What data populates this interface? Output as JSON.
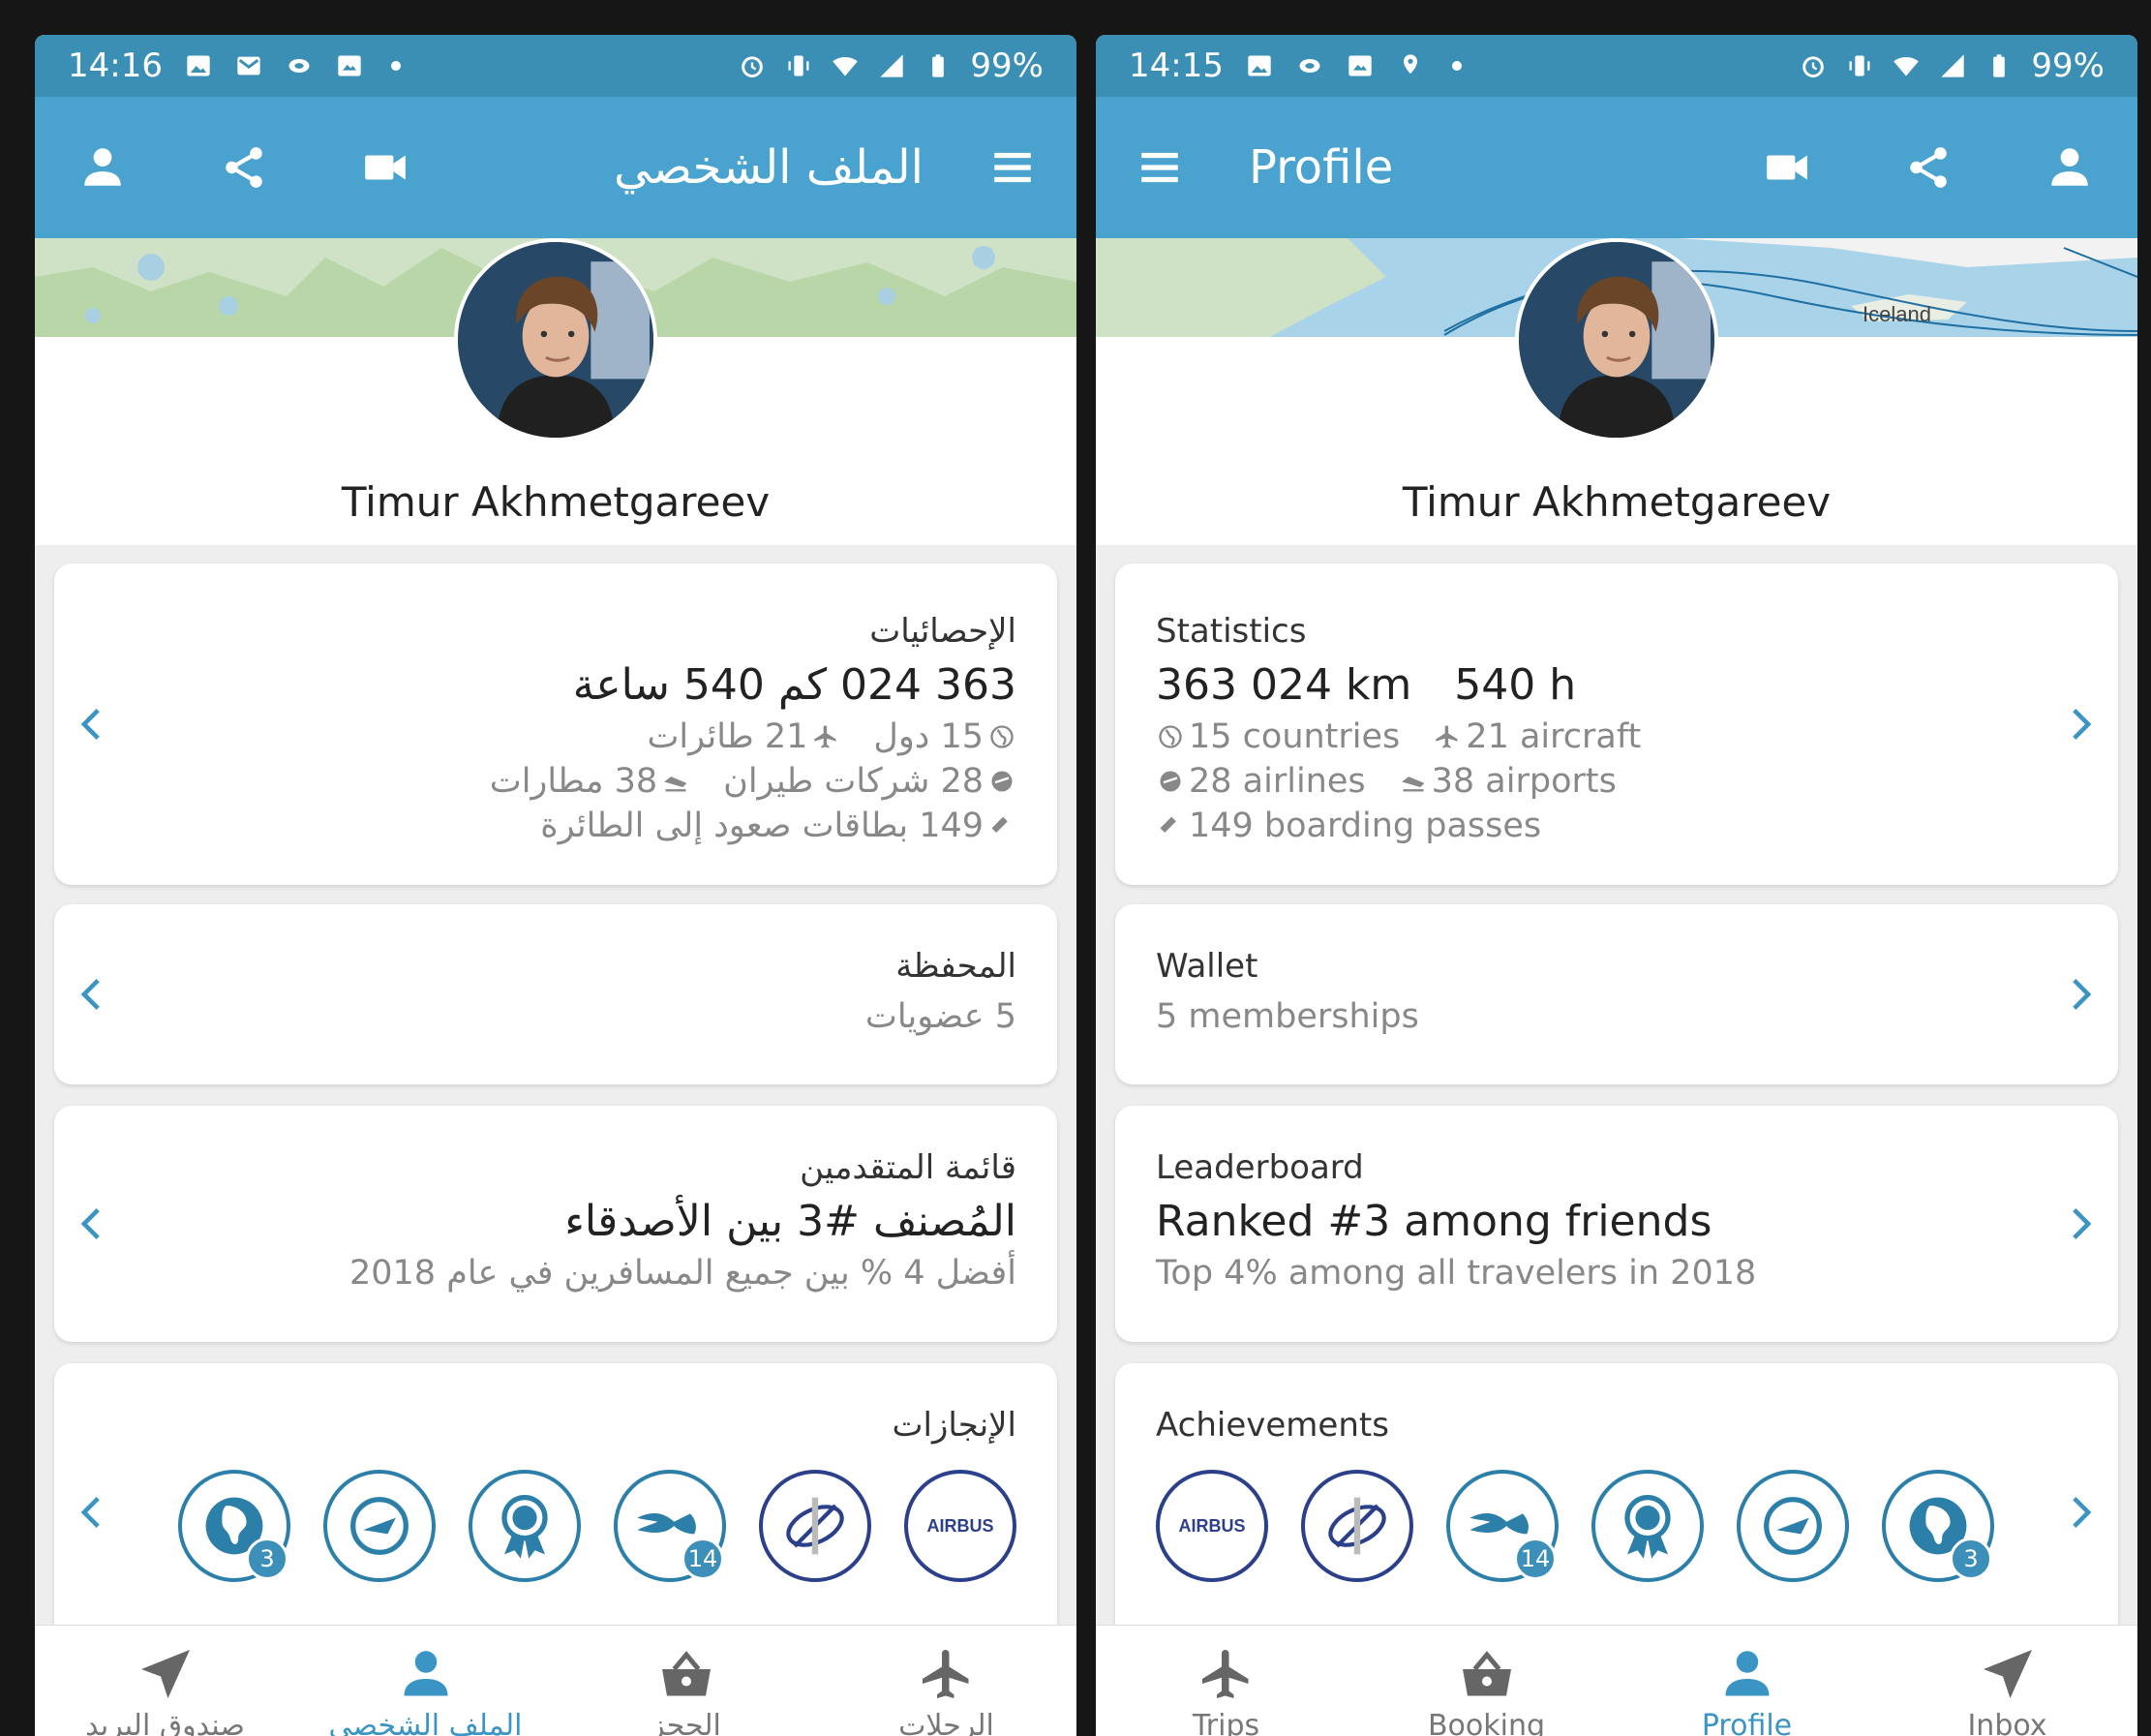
{
  "colors": {
    "statusbar": "#3b8fb5",
    "appbar": "#4aa3cf",
    "accent": "#3b95c4",
    "badge_blue": "#2b7fa9",
    "badge_navy": "#2c3f8a",
    "nav_inactive": "#666666"
  },
  "left": {
    "statusbar": {
      "time": "14:16",
      "left_icons": [
        "image-icon",
        "gmail-icon",
        "ring-icon",
        "photo-icon",
        "dot-icon"
      ],
      "right_icons": [
        "alarm-icon",
        "vibrate-icon",
        "wifi-icon",
        "signal-icon",
        "battery-icon"
      ],
      "battery": "99%"
    },
    "appbar": {
      "title": "الملف الشخصي",
      "icons": [
        "person-icon",
        "share-icon",
        "videocam-icon",
        "menu-icon"
      ]
    },
    "profile": {
      "name": "Timur Akhmetgareev"
    },
    "statistics": {
      "title": "الإحصائيات",
      "totals": "363 024 كم   540 ساعة",
      "countries": "15 دول",
      "aircraft": "21 طائرات",
      "airlines": "28 شركات طيران",
      "airports": "38 مطارات",
      "boarding_passes": "149 بطاقات صعود إلى الطائرة"
    },
    "wallet": {
      "title": "المحفظة",
      "subtitle": "5 عضويات"
    },
    "leaderboard": {
      "title": "قائمة المتقدمين",
      "rank": "المُصنف #3 بين الأصدقاء",
      "subtitle": "أفضل 4 % بين جميع المسافرين في عام 2018"
    },
    "achievements": {
      "title": "الإنجازات",
      "badges": [
        {
          "icon": "airbus-badge-icon",
          "text": "AIRBUS",
          "count": ""
        },
        {
          "icon": "boeing-badge-icon",
          "count": ""
        },
        {
          "icon": "eagle-badge-icon",
          "count": "14"
        },
        {
          "icon": "medal-badge-icon",
          "count": ""
        },
        {
          "icon": "globe-plane-badge-icon",
          "count": ""
        },
        {
          "icon": "africa-globe-badge-icon",
          "count": "3"
        }
      ]
    },
    "nav": [
      {
        "label": "الرحلات",
        "icon": "airplane-icon",
        "active": false
      },
      {
        "label": "الحجز",
        "icon": "basket-icon",
        "active": false
      },
      {
        "label": "الملف الشخصي",
        "icon": "person-icon",
        "active": true
      },
      {
        "label": "صندوق البريد",
        "icon": "send-icon",
        "active": false
      }
    ]
  },
  "right": {
    "statusbar": {
      "time": "14:15",
      "left_icons": [
        "image-icon",
        "ring-icon",
        "photo-icon",
        "location-settings-icon",
        "dot-icon"
      ],
      "right_icons": [
        "alarm-icon",
        "vibrate-icon",
        "wifi-icon",
        "signal-icon",
        "battery-icon"
      ],
      "battery": "99%"
    },
    "appbar": {
      "title": "Profile",
      "icons": [
        "menu-icon",
        "videocam-icon",
        "share-icon",
        "person-icon"
      ]
    },
    "profile": {
      "name": "Timur Akhmetgareev",
      "map_label": "Iceland"
    },
    "statistics": {
      "title": "Statistics",
      "distance": "363 024 km",
      "hours": "540 h",
      "countries": "15 countries",
      "aircraft": "21 aircraft",
      "airlines": "28 airlines",
      "airports": "38 airports",
      "boarding_passes": "149 boarding passes"
    },
    "wallet": {
      "title": "Wallet",
      "subtitle": "5 memberships"
    },
    "leaderboard": {
      "title": "Leaderboard",
      "rank": "Ranked #3 among friends",
      "subtitle": "Top 4% among all travelers in 2018"
    },
    "achievements": {
      "title": "Achievements",
      "badges": [
        {
          "icon": "airbus-badge-icon",
          "text": "AIRBUS",
          "count": ""
        },
        {
          "icon": "boeing-badge-icon",
          "count": ""
        },
        {
          "icon": "eagle-badge-icon",
          "count": "14"
        },
        {
          "icon": "medal-badge-icon",
          "count": ""
        },
        {
          "icon": "globe-plane-badge-icon",
          "count": ""
        },
        {
          "icon": "africa-globe-badge-icon",
          "count": "3"
        }
      ]
    },
    "nav": [
      {
        "label": "Trips",
        "icon": "airplane-icon",
        "active": false
      },
      {
        "label": "Booking",
        "icon": "basket-icon",
        "active": false
      },
      {
        "label": "Profile",
        "icon": "person-icon",
        "active": true
      },
      {
        "label": "Inbox",
        "icon": "send-icon",
        "active": false
      }
    ]
  }
}
